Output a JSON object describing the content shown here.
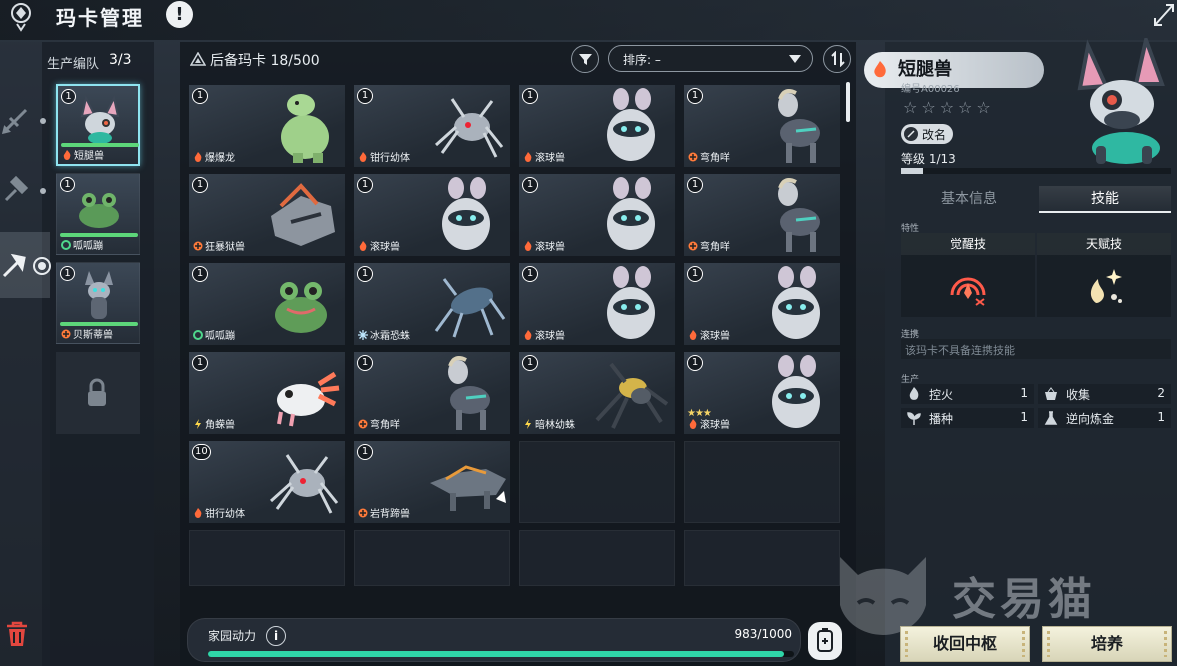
{
  "header": {
    "title": "玛卡管理"
  },
  "team": {
    "label": "生产编队",
    "count": "3/3",
    "members": [
      {
        "level": "1",
        "name": "短腿兽",
        "element": "fire",
        "kind": "bunnydog"
      },
      {
        "level": "1",
        "name": "呱呱蹦",
        "element": "grass",
        "kind": "frog"
      },
      {
        "level": "1",
        "name": "贝斯蒂兽",
        "element": "none",
        "kind": "cat"
      }
    ]
  },
  "grid": {
    "reserve_label": "后备玛卡",
    "reserve_count": "18/500",
    "sort_label": "排序: –",
    "cards": [
      {
        "level": "1",
        "name": "爆爆龙",
        "element": "fire",
        "kind": "dino"
      },
      {
        "level": "1",
        "name": "钳行幼体",
        "element": "fire",
        "kind": "spider"
      },
      {
        "level": "1",
        "name": "滚球兽",
        "element": "fire",
        "kind": "ball"
      },
      {
        "level": "1",
        "name": "弯角咩",
        "element": "plus",
        "kind": "goat"
      },
      {
        "level": "1",
        "name": "狂暴狱兽",
        "element": "plus",
        "kind": "beast"
      },
      {
        "level": "1",
        "name": "滚球兽",
        "element": "fire",
        "kind": "ball"
      },
      {
        "level": "1",
        "name": "滚球兽",
        "element": "fire",
        "kind": "ball"
      },
      {
        "level": "1",
        "name": "弯角咩",
        "element": "plus",
        "kind": "goat"
      },
      {
        "level": "1",
        "name": "呱呱蹦",
        "element": "grass",
        "kind": "frog"
      },
      {
        "level": "1",
        "name": "冰霜恐蛛",
        "element": "ice",
        "kind": "icespider"
      },
      {
        "level": "1",
        "name": "滚球兽",
        "element": "fire",
        "kind": "ball"
      },
      {
        "level": "1",
        "name": "滚球兽",
        "element": "fire",
        "kind": "ball"
      },
      {
        "level": "1",
        "name": "角蝾兽",
        "element": "bolt",
        "kind": "axolotl"
      },
      {
        "level": "1",
        "name": "弯角咩",
        "element": "plus",
        "kind": "goat"
      },
      {
        "level": "1",
        "name": "暗林幼蛛",
        "element": "bolt",
        "kind": "spider2"
      },
      {
        "level": "1",
        "name": "滚球兽",
        "element": "fire",
        "kind": "ball",
        "stars": "★★★"
      },
      {
        "level": "10",
        "name": "钳行幼体",
        "element": "fire",
        "kind": "spider"
      },
      {
        "level": "1",
        "name": "岩背蹄兽",
        "element": "plus",
        "kind": "lizard"
      }
    ]
  },
  "energy": {
    "label": "家园动力",
    "value": "983/1000",
    "fraction": 0.983
  },
  "detail": {
    "name": "短腿兽",
    "id": "编号A00026",
    "stars": "☆☆☆☆☆",
    "rename": "改名",
    "level": "等级  1/13",
    "level_fraction": 0.08,
    "tabs": {
      "basic": "基本信息",
      "skill": "技能"
    },
    "trait_head": "特性",
    "awaken_skill": "觉醒技",
    "talent_skill": "天赋技",
    "combo_head": "连携",
    "combo_text": "该玛卡不具备连携技能",
    "work_head": "生产",
    "work": [
      {
        "name": "控火",
        "value": "1",
        "icon": "fire-icon"
      },
      {
        "name": "收集",
        "value": "2",
        "icon": "basket-icon"
      },
      {
        "name": "播种",
        "value": "1",
        "icon": "sprout-icon"
      },
      {
        "name": "逆向炼金",
        "value": "1",
        "icon": "flask-icon"
      }
    ]
  },
  "buttons": {
    "recall": "收回中枢",
    "train": "培养"
  },
  "watermark": "交易猫",
  "colors": {
    "accent": "#2fd6a8",
    "fire": "#ff6a3a",
    "grass": "#4fd88c",
    "bolt": "#ffd84a",
    "ice": "#bfe8ff",
    "selected": "#8fe4f0"
  }
}
